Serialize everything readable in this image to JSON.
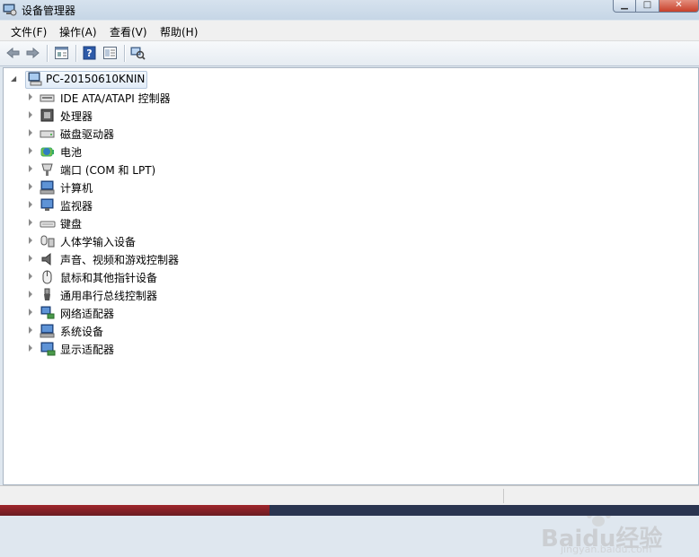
{
  "window": {
    "title": "设备管理器",
    "min_glyph": "▁",
    "max_glyph": "□",
    "close_glyph": "✕"
  },
  "menu": [
    "文件(F)",
    "操作(A)",
    "查看(V)",
    "帮助(H)"
  ],
  "toolbar": {
    "buttons": [
      "back-arrow-icon",
      "forward-arrow-icon",
      "properties-icon",
      "help-icon",
      "view-icon",
      "scan-hardware-icon"
    ]
  },
  "tree": {
    "root_label": "PC-20150610KNIN",
    "categories": [
      {
        "label": "IDE ATA/ATAPI 控制器",
        "icon": "ide-controller-icon"
      },
      {
        "label": "处理器",
        "icon": "processor-icon"
      },
      {
        "label": "磁盘驱动器",
        "icon": "disk-drive-icon"
      },
      {
        "label": "电池",
        "icon": "battery-icon"
      },
      {
        "label": "端口 (COM 和 LPT)",
        "icon": "port-icon"
      },
      {
        "label": "计算机",
        "icon": "computer-icon"
      },
      {
        "label": "监视器",
        "icon": "monitor-icon"
      },
      {
        "label": "键盘",
        "icon": "keyboard-icon"
      },
      {
        "label": "人体学输入设备",
        "icon": "hid-icon"
      },
      {
        "label": "声音、视频和游戏控制器",
        "icon": "sound-icon"
      },
      {
        "label": "鼠标和其他指针设备",
        "icon": "mouse-icon"
      },
      {
        "label": "通用串行总线控制器",
        "icon": "usb-icon"
      },
      {
        "label": "网络适配器",
        "icon": "network-adapter-icon"
      },
      {
        "label": "系统设备",
        "icon": "system-device-icon"
      },
      {
        "label": "显示适配器",
        "icon": "display-adapter-icon"
      }
    ]
  },
  "watermark": {
    "brand": "Baidu经验",
    "url": "jingyan.baidu.com"
  }
}
